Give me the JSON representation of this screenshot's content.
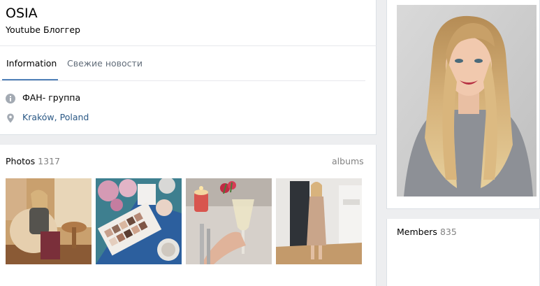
{
  "profile": {
    "name": "OSIA",
    "status": "Youtube Блоггер"
  },
  "tabs": [
    {
      "label": "Information",
      "active": true
    },
    {
      "label": "Свежие новости",
      "active": false
    }
  ],
  "info": {
    "about": {
      "icon": "info-icon",
      "text": "ФАН- группа"
    },
    "location": {
      "icon": "location-pin-icon",
      "text": "Kraków, Poland"
    }
  },
  "photos": {
    "label": "Photos",
    "count": "1317",
    "albums_label": "albums"
  },
  "members": {
    "label": "Members",
    "count": "835"
  },
  "colors": {
    "accent": "#5181b8",
    "link": "#2a5885",
    "muted": "#828282",
    "background": "#edeef0"
  }
}
